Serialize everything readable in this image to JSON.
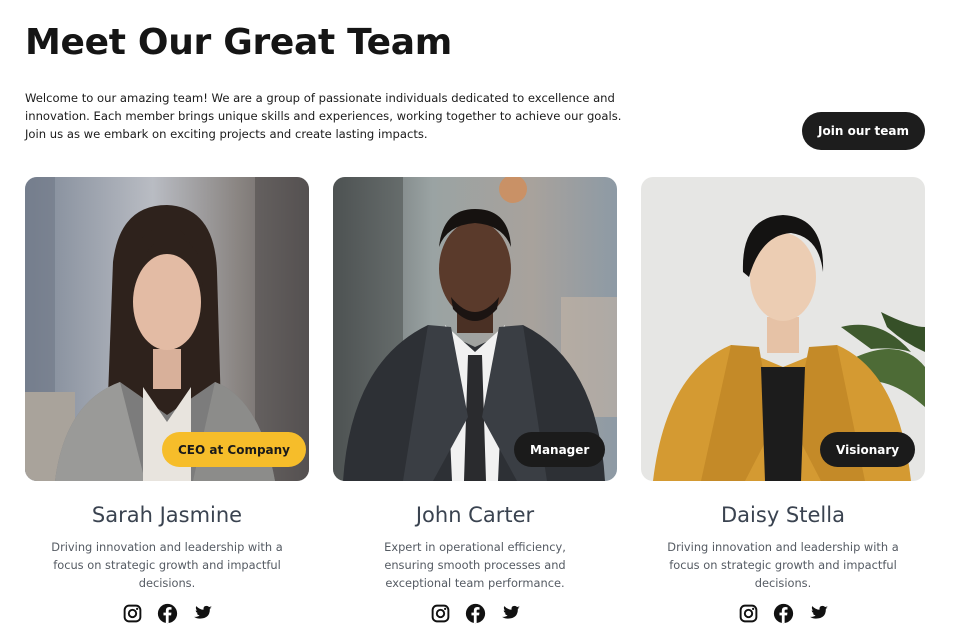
{
  "header": {
    "title": "Meet Our Great Team",
    "intro": "Welcome to our amazing team! We are a group of passionate individuals dedicated to excellence and innovation. Each member brings unique skills and experiences, working together to achieve our goals. Join us as we embark on exciting projects and create lasting impacts.",
    "join_label": "Join our team"
  },
  "team": [
    {
      "name": "Sarah Jasmine",
      "role": "CEO at Company",
      "description": "Driving innovation and leadership with a focus on strategic growth and impactful decisions.",
      "badge_color": "#f6bd2a"
    },
    {
      "name": "John Carter",
      "role": "Manager",
      "description": "Expert in operational efficiency, ensuring smooth processes and exceptional team performance.",
      "badge_color": "#1b1b1b"
    },
    {
      "name": "Daisy Stella",
      "role": "Visionary",
      "description": "Driving innovation and leadership with a focus on strategic growth and impactful decisions.",
      "badge_color": "#1b1b1b"
    }
  ],
  "social_icons": [
    "instagram-icon",
    "facebook-icon",
    "twitter-icon"
  ]
}
